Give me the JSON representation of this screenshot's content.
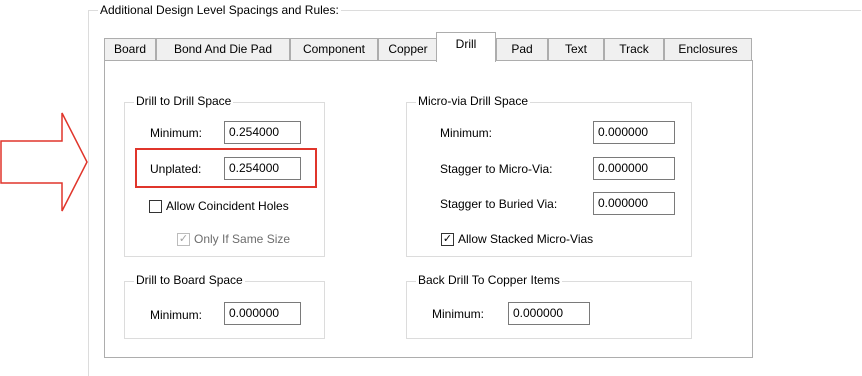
{
  "outer_group_title": "Additional Design Level Spacings and Rules:",
  "tabs": [
    {
      "label": "Board"
    },
    {
      "label": "Bond And Die Pad"
    },
    {
      "label": "Component"
    },
    {
      "label": "Copper"
    },
    {
      "label": "Drill"
    },
    {
      "label": "Pad"
    },
    {
      "label": "Text"
    },
    {
      "label": "Track"
    },
    {
      "label": "Enclosures"
    }
  ],
  "active_tab": "Drill",
  "drill_to_drill": {
    "title": "Drill to Drill Space",
    "minimum_label": "Minimum:",
    "minimum_value": "0.254000",
    "unplated_label": "Unplated:",
    "unplated_value": "0.254000",
    "allow_coincident_label": "Allow Coincident Holes",
    "allow_coincident_checked": false,
    "only_same_size_label": "Only If Same Size",
    "only_same_size_checked": true,
    "only_same_size_enabled": false
  },
  "micro_via": {
    "title": "Micro-via Drill Space",
    "minimum_label": "Minimum:",
    "minimum_value": "0.000000",
    "stagger_micro_label": "Stagger to Micro-Via:",
    "stagger_micro_value": "0.000000",
    "stagger_buried_label": "Stagger to Buried Via:",
    "stagger_buried_value": "0.000000",
    "allow_stacked_label": "Allow Stacked Micro-Vias",
    "allow_stacked_checked": true
  },
  "drill_to_board": {
    "title": "Drill to Board Space",
    "minimum_label": "Minimum:",
    "minimum_value": "0.000000"
  },
  "back_drill": {
    "title": "Back Drill To Copper Items",
    "minimum_label": "Minimum:",
    "minimum_value": "0.000000"
  },
  "annotation": {
    "arrow_color": "#e0352b",
    "highlight_color": "#e0352b"
  },
  "checkmark_glyph": "✓"
}
